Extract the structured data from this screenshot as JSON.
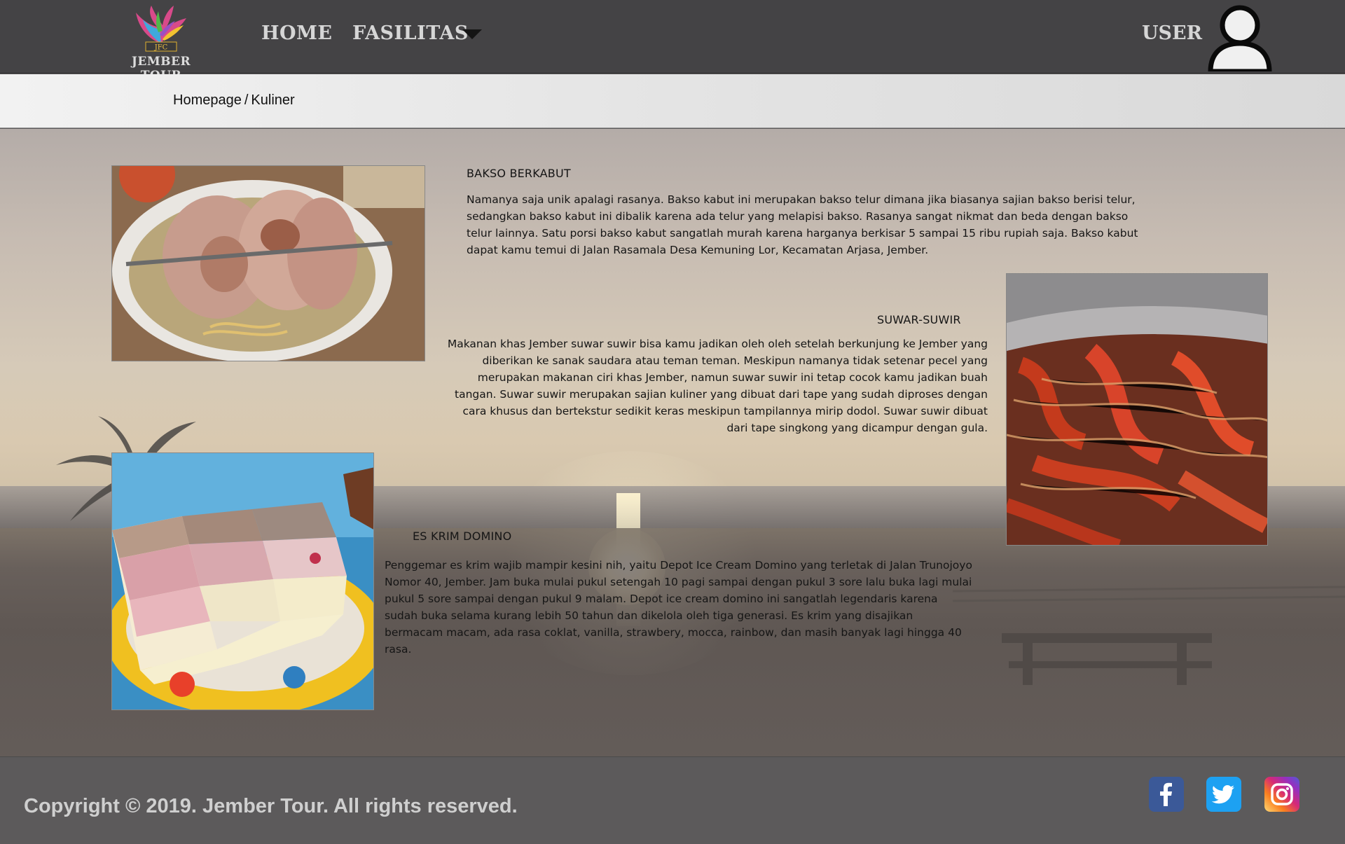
{
  "nav": {
    "logo_text": "JEMBER TOUR",
    "home": "HOME",
    "fasilitas": "FASILITAS",
    "user": "USER"
  },
  "breadcrumb": {
    "home": "Homepage",
    "separator": "/",
    "current": "Kuliner"
  },
  "items": [
    {
      "title": "BAKSO BERKABUT",
      "description": "Namanya saja unik apalagi rasanya. Bakso kabut ini merupakan bakso telur dimana jika biasanya sajian bakso berisi telur, sedangkan bakso kabut ini dibalik karena ada telur yang melapisi bakso. Rasanya sangat nikmat dan beda dengan bakso telur lainnya. Satu porsi bakso kabut sangatlah murah karena harganya berkisar 5 sampai 15 ribu rupiah saja. Bakso kabut dapat kamu temui di Jalan Rasamala Desa Kemuning Lor, Kecamatan Arjasa, Jember."
    },
    {
      "title": "SUWAR-SUWIR",
      "description": "Makanan khas Jember suwar suwir bisa kamu jadikan oleh oleh setelah berkunjung ke Jember yang diberikan ke sanak saudara atau teman teman. Meskipun namanya tidak setenar pecel yang merupakan makanan ciri khas Jember, namun suwar suwir ini tetap cocok kamu jadikan buah tangan. Suwar suwir merupakan sajian kuliner yang dibuat dari tape yang sudah diproses dengan cara khusus dan bertekstur sedikit keras meskipun tampilannya mirip dodol. Suwar suwir dibuat dari tape singkong yang dicampur dengan gula."
    },
    {
      "title": "ES KRIM DOMINO",
      "description": "Penggemar es krim wajib mampir kesini nih, yaitu Depot Ice Cream Domino yang terletak di Jalan Trunojoyo Nomor 40, Jember. Jam buka mulai pukul setengah 10 pagi sampai dengan pukul 3 sore lalu buka lagi mulai pukul 5 sore sampai dengan pukul 9 malam. Depot ice cream domino ini sangatlah legendaris karena sudah buka selama kurang lebih 50 tahun dan dikelola oleh tiga generasi. Es krim yang disajikan bermacam macam, ada rasa coklat, vanilla, strawbery, mocca, rainbow, dan masih banyak lagi hingga 40 rasa."
    }
  ],
  "footer": {
    "copyright": "Copyright © 2019. Jember Tour. All rights reserved."
  },
  "colors": {
    "navbar": "#444345",
    "footer": "#5c5a5b",
    "facebook": "#3b5998",
    "twitter": "#1da1f2"
  },
  "icons": [
    "user-avatar-icon",
    "chevron-down-icon",
    "facebook-icon",
    "twitter-icon",
    "instagram-icon"
  ]
}
